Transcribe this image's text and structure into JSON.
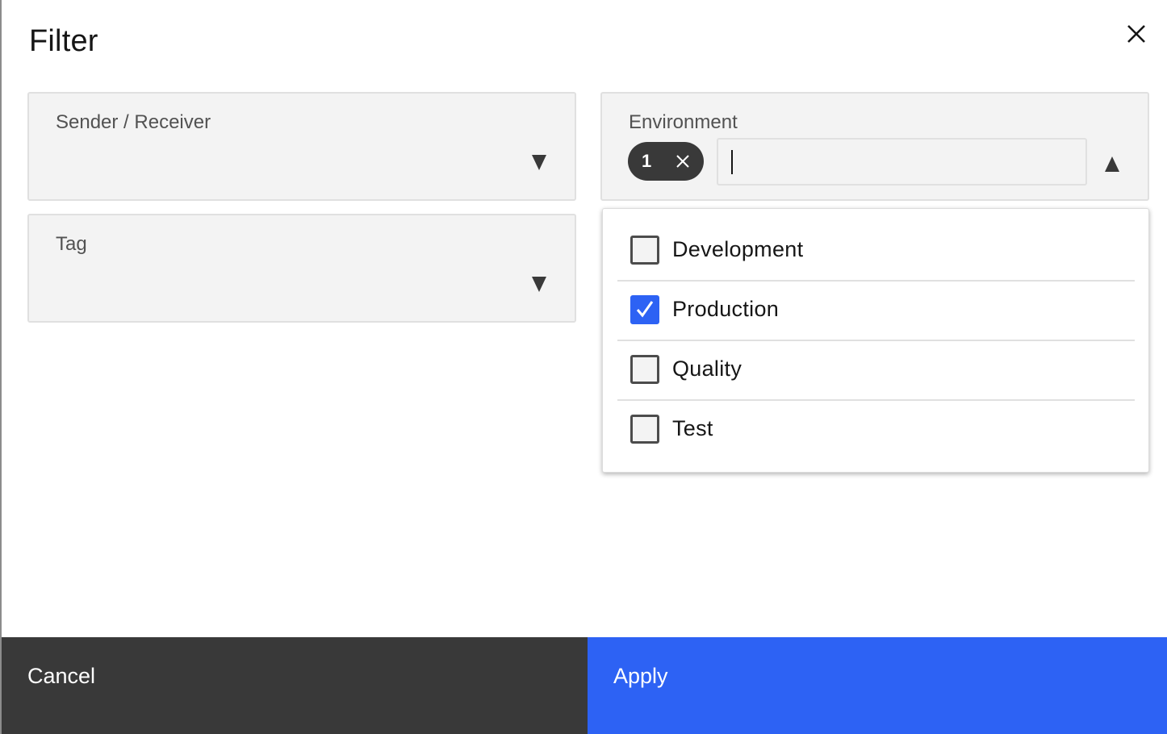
{
  "dialog": {
    "title": "Filter"
  },
  "fields": {
    "sender_receiver": {
      "label": "Sender / Receiver"
    },
    "tag": {
      "label": "Tag"
    },
    "environment": {
      "label": "Environment",
      "selected_count": "1",
      "search_value": "",
      "options": [
        {
          "label": "Development",
          "checked": false
        },
        {
          "label": "Production",
          "checked": true
        },
        {
          "label": "Quality",
          "checked": false
        },
        {
          "label": "Test",
          "checked": false
        }
      ]
    }
  },
  "footer": {
    "cancel_label": "Cancel",
    "apply_label": "Apply"
  },
  "colors": {
    "primary": "#2d62f4",
    "secondary_button": "#393939",
    "field_background": "#f3f3f3",
    "chip": "#393939"
  },
  "icons": {
    "close": "close-icon",
    "caret_down": "caret-down-icon",
    "caret_up": "caret-up-icon",
    "checkmark": "checkmark-icon"
  }
}
